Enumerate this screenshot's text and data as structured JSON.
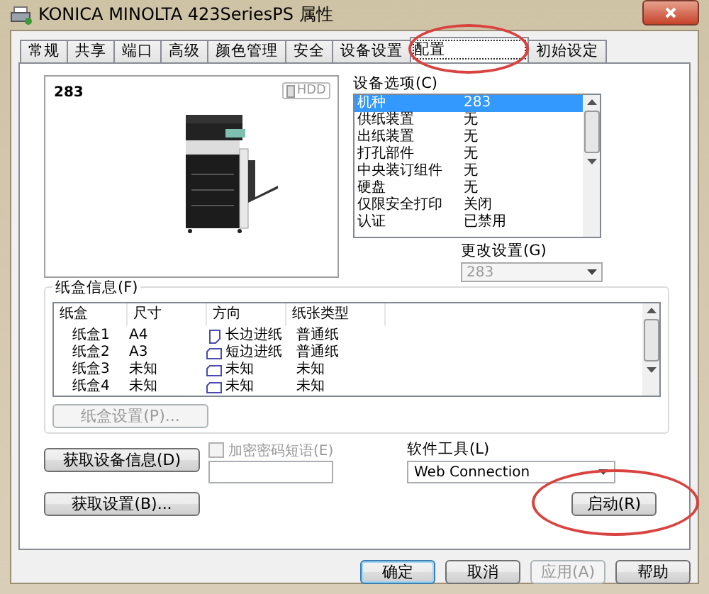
{
  "window": {
    "title": "KONICA MINOLTA 423SeriesPS 属性"
  },
  "tabs": [
    {
      "label": "常规",
      "selected": false,
      "circled": false
    },
    {
      "label": "共享",
      "selected": false,
      "circled": false
    },
    {
      "label": "端口",
      "selected": false,
      "circled": false
    },
    {
      "label": "高级",
      "selected": false,
      "circled": false
    },
    {
      "label": "颜色管理",
      "selected": false,
      "circled": false
    },
    {
      "label": "安全",
      "selected": false,
      "circled": false
    },
    {
      "label": "设备设置",
      "selected": false,
      "circled": false
    },
    {
      "label": "配置",
      "selected": true,
      "circled": true
    },
    {
      "label": "初始设定",
      "selected": false,
      "circled": false
    }
  ],
  "preview": {
    "model": "283",
    "badge": "HDD"
  },
  "device_options": {
    "label": "设备选项(C)",
    "rows": [
      {
        "name": "机种",
        "value": "283",
        "selected": true
      },
      {
        "name": "供纸装置",
        "value": "无",
        "selected": false
      },
      {
        "name": "出纸装置",
        "value": "无",
        "selected": false
      },
      {
        "name": "打孔部件",
        "value": "无",
        "selected": false
      },
      {
        "name": "中央装订组件",
        "value": "无",
        "selected": false
      },
      {
        "name": "硬盘",
        "value": "无",
        "selected": false
      },
      {
        "name": "仅限安全打印",
        "value": "关闭",
        "selected": false
      },
      {
        "name": "认证",
        "value": "已禁用",
        "selected": false
      }
    ]
  },
  "change_setting": {
    "label": "更改设置(G)",
    "value": "283",
    "disabled": true
  },
  "tray_info": {
    "label": "纸盒信息(F)",
    "columns": [
      "纸盒",
      "尺寸",
      "方向",
      "纸张类型"
    ],
    "rows": [
      {
        "tray": "纸盒1",
        "size": "A4",
        "orientation": "长边进纸",
        "kind": "portrait",
        "type": "普通纸"
      },
      {
        "tray": "纸盒2",
        "size": "A3",
        "orientation": "短边进纸",
        "kind": "landscape",
        "type": "普通纸"
      },
      {
        "tray": "纸盒3",
        "size": "未知",
        "orientation": "未知",
        "kind": "landscape",
        "type": "未知"
      },
      {
        "tray": "纸盒4",
        "size": "未知",
        "orientation": "未知",
        "kind": "landscape",
        "type": "未知"
      }
    ],
    "button": {
      "label": "纸盒设置(P)...",
      "disabled": true
    }
  },
  "get_device_info_button": {
    "label": "获取设备信息(D)"
  },
  "encrypt": {
    "label": "加密密码短语(E)",
    "checked": false,
    "disabled": true
  },
  "software_tool": {
    "label": "软件工具(L)",
    "value": "Web Connection"
  },
  "get_settings_button": {
    "label": "获取设置(B)..."
  },
  "launch_button": {
    "label": "启动(R)",
    "circled": true
  },
  "dialog_buttons": [
    {
      "label": "确定",
      "default": true,
      "disabled": false
    },
    {
      "label": "取消",
      "default": false,
      "disabled": false
    },
    {
      "label": "应用(A)",
      "default": false,
      "disabled": true
    },
    {
      "label": "帮助",
      "default": false,
      "disabled": false
    }
  ]
}
